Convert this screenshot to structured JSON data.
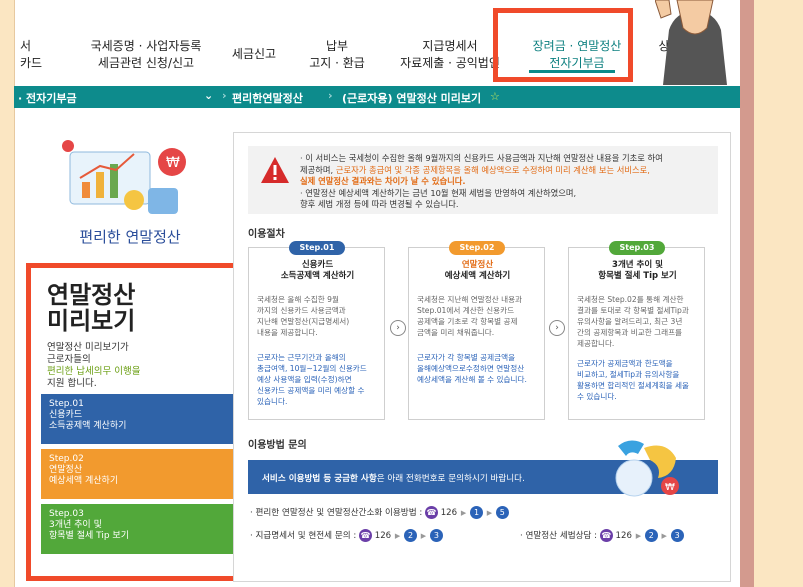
{
  "nav": {
    "items": [
      {
        "line1": "서",
        "line2": "카드"
      },
      {
        "line1": "국세증명 · 사업자등록",
        "line2": "세금관련 신청/신고"
      },
      {
        "line1": "세금신고",
        "line2": ""
      },
      {
        "line1": "납부",
        "line2": "고지 · 환급"
      },
      {
        "line1": "지급명세서",
        "line2": "자료제출 · 공익법인"
      },
      {
        "line1": "장려금 · 연말정산",
        "line2": "전자기부금"
      },
      {
        "line1": "상",
        "line2": ""
      }
    ]
  },
  "breadcrumb": {
    "section": "· 전자기부금",
    "item1": "편리한연말정산",
    "item2": "(근로자용) 연말정산 미리보기",
    "star": "☆"
  },
  "left": {
    "title": "편리한 연말정산",
    "preview_heading_1": "연말정산",
    "preview_heading_2": "미리보기",
    "desc_1": "연말정산 미리보기가",
    "desc_2": "근로자들의",
    "desc_3": "편리한 납세의무 이행을",
    "desc_4": "지원 합니다.",
    "steps": [
      {
        "label": "Step.01",
        "line1": "신용카드",
        "line2": "소득공제액 계산하기",
        "color": "#2f63a8"
      },
      {
        "label": "Step.02",
        "line1": "연말정산",
        "line2": "예상세액 계산하기",
        "color": "#f29a2e"
      },
      {
        "label": "Step.03",
        "line1": "3개년 추이 및",
        "line2": "항목별 절세 Tip 보기",
        "color": "#52a83a"
      }
    ]
  },
  "notice": {
    "line1": "· 이 서비스는 국세청이 수집한 올해 9월까지의 신용카드 사용금액과 지난해 연말정산 내용을 기초로 하여",
    "line2a": "제공하며, ",
    "line2b": "근로자가 총급여 및 각종 공제항목을 올해 예상액으로 수정하여 미리 계산해 보는 서비스로,",
    "line3": "실제 연말정산 결과와는 차이가 날 수 있습니다.",
    "line4": "· 연말정산 예상세액 계산하기는 금년 10월 현재 세법을 반영하여 계산하였으며,",
    "line5": "향후 세법 개정 등에 따라 변경될 수 있습니다."
  },
  "procedure": {
    "title": "이용절차",
    "cards": [
      {
        "pill": "Step.01",
        "pill_color": "#2f63a8",
        "title1": "신용카드",
        "title2": "소득공제액 계산하기",
        "p": [
          "국세청은 올해 수집한 9월",
          "까지의 신용카드 사용금액과",
          "지난해 연말정산(지급명세서)",
          "내용을 제공합니다."
        ],
        "hl": [
          "근로자는 근무기간과 올해의",
          "총급여액, 10월~12월의 신용카드",
          "예상 사용액을 입력(수정)하면",
          "신용카드 공제액을 미리 예상할 수",
          "있습니다."
        ]
      },
      {
        "pill": "Step.02",
        "pill_color": "#f29a2e",
        "title1": "연말정산",
        "title2": "예상세액 계산하기",
        "p": [
          "국세청은 지난해 연말정산 내용과",
          "Step.01에서 계산한 신용카드",
          "공제액을 기초로 각 항목별 공제",
          "금액을 미리 채워줍니다."
        ],
        "hl": [
          "근로자가 각 항목별 공제금액을",
          "올해예상액으로수정하면 연말정산",
          "예상세액을 계산해 볼 수 있습니다."
        ]
      },
      {
        "pill": "Step.03",
        "pill_color": "#52a83a",
        "title1": "3개년 추이 및",
        "title2": "항목별 절세 Tip 보기",
        "p": [
          "국세청은 Step.02를 통해 계산한",
          "결과를 토대로 각 항목별 절세Tip과",
          "유의사항을 알려드리고, 최근 3년",
          "간의 공제항목과 비교한 그래프를",
          "제공합니다."
        ],
        "hl": [
          "근로자가 공제금액과 한도액을",
          "비교하고, 절세Tip과 유의사항을",
          "활용하면 합리적인 절세계획을 세울",
          "수 있습니다."
        ]
      }
    ]
  },
  "inquiry": {
    "title": "이용방법 문의",
    "banner_bold": "서비스 이용방법 등 궁금한 사항",
    "banner_rest": "은 아래 전화번호로 문의하시기 바랍니다.",
    "contact1_label": "· 편리한 연말정산 및 연말정산간소화 이용방법 :",
    "contact1_nums": [
      "126",
      "1",
      "5"
    ],
    "contact2_label": "· 지급명세서 및 현전세 문의 :",
    "contact2_nums": [
      "126",
      "2",
      "3"
    ],
    "contact3_label": "· 연말정산 세법상담 :",
    "contact3_nums": [
      "126",
      "2",
      "3"
    ]
  }
}
